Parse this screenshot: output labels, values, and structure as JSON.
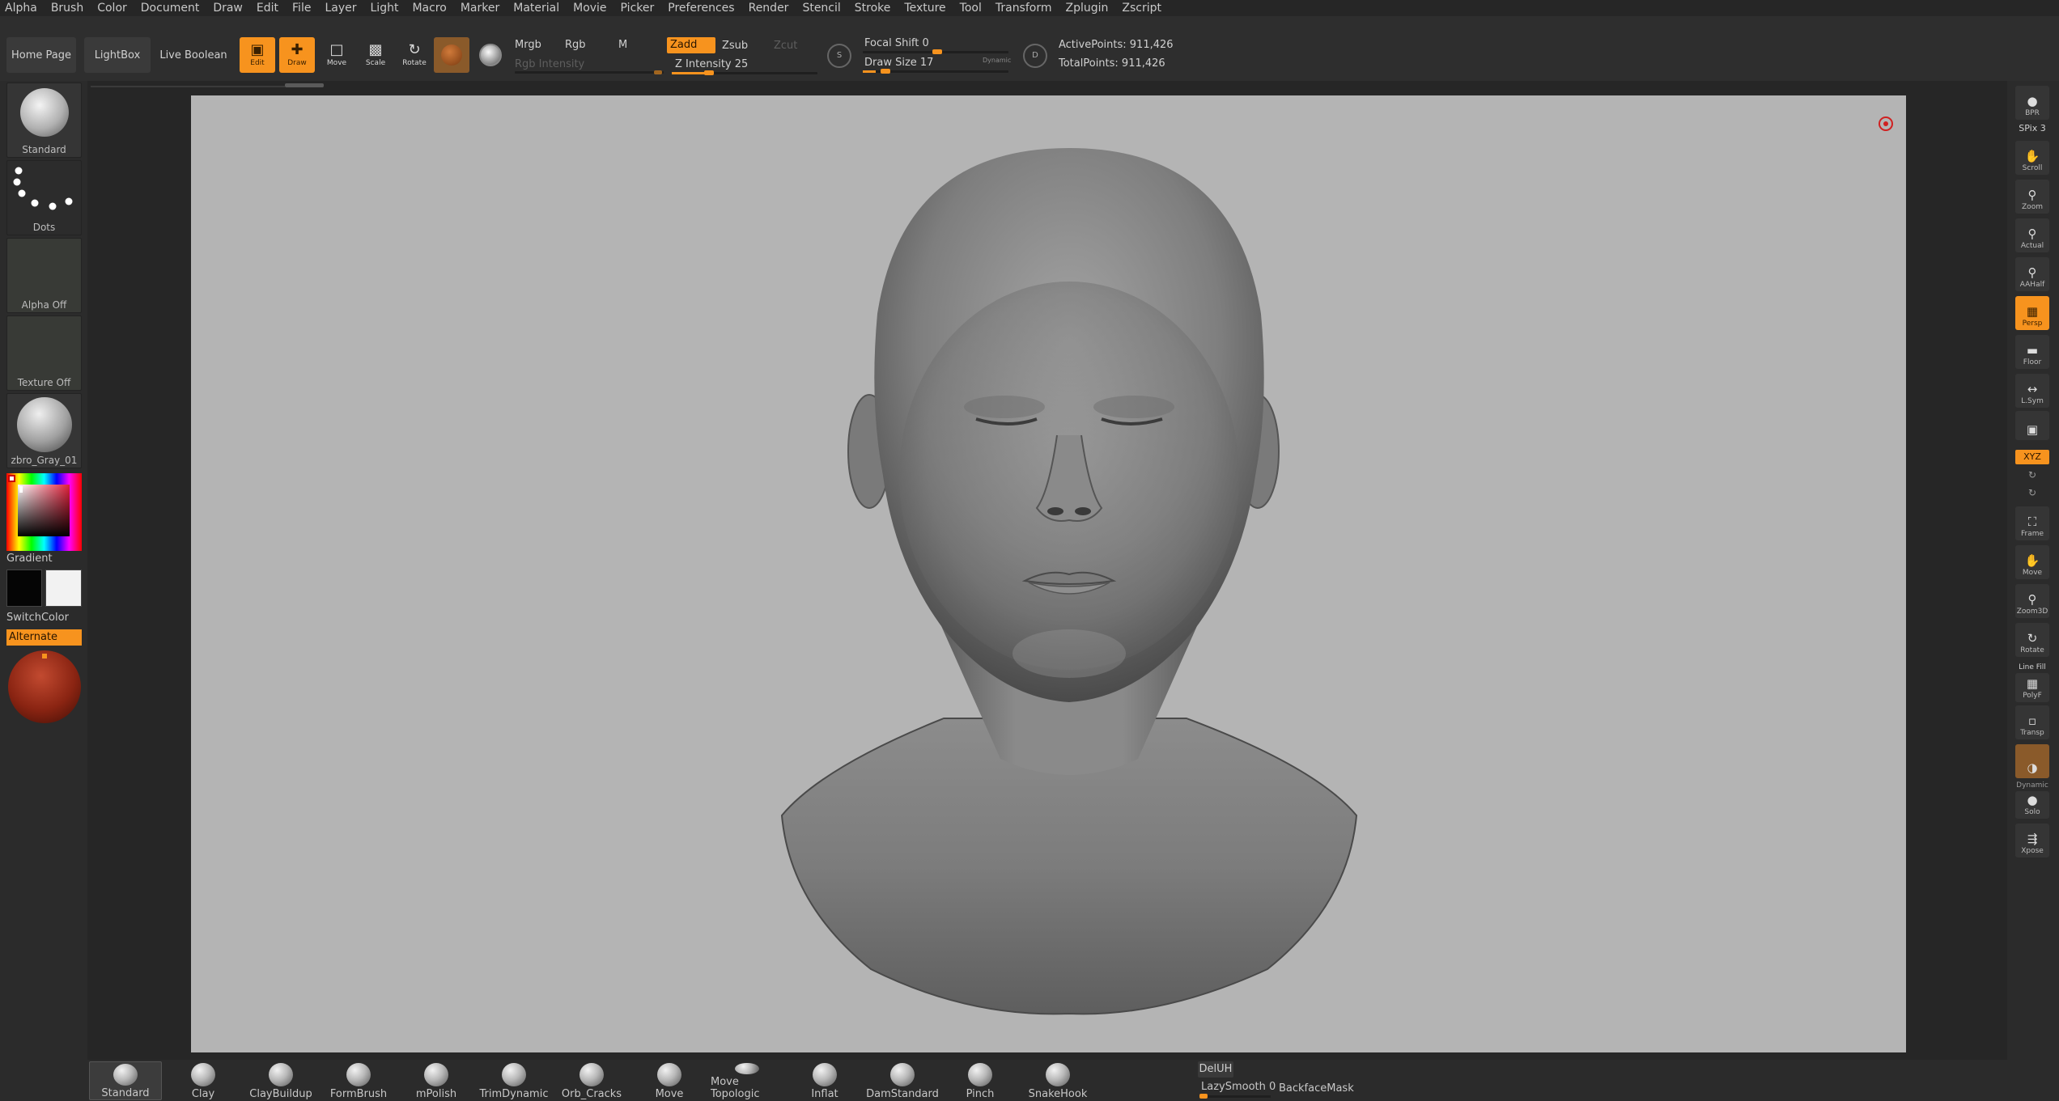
{
  "menu": [
    "Alpha",
    "Brush",
    "Color",
    "Document",
    "Draw",
    "Edit",
    "File",
    "Layer",
    "Light",
    "Macro",
    "Marker",
    "Material",
    "Movie",
    "Picker",
    "Preferences",
    "Render",
    "Stencil",
    "Stroke",
    "Texture",
    "Tool",
    "Transform",
    "Zplugin",
    "Zscript"
  ],
  "toolbar": {
    "home_page": "Home Page",
    "lightbox": "LightBox",
    "live_boolean": "Live Boolean",
    "edit": "Edit",
    "draw": "Draw",
    "move": "Move",
    "scale": "Scale",
    "rotate": "Rotate",
    "mrgb": "Mrgb",
    "rgb": "Rgb",
    "m": "M",
    "rgb_intensity": "Rgb Intensity",
    "zadd": "Zadd",
    "zsub": "Zsub",
    "zcut": "Zcut",
    "z_intensity": "Z Intensity 25",
    "z_intensity_value": 25,
    "focal_shift": "Focal Shift 0",
    "draw_size": "Draw Size 17",
    "dynamic": "Dynamic",
    "active_points": "ActivePoints: 911,426",
    "total_points": "TotalPoints: 911,426"
  },
  "left_shelf": {
    "brush": "Standard",
    "stroke": "Dots",
    "alpha": "Alpha Off",
    "texture": "Texture Off",
    "material": "zbro_Gray_01",
    "gradient": "Gradient",
    "switch_color": "SwitchColor",
    "alternate": "Alternate"
  },
  "right_shelf": {
    "bpr": "BPR",
    "spix": "SPix 3",
    "scroll": "Scroll",
    "zoom": "Zoom",
    "actual": "Actual",
    "aahalf": "AAHalf",
    "persp": "Persp",
    "floor": "Floor",
    "lsym": "L.Sym",
    "xyz": "XYZ",
    "frame": "Frame",
    "move": "Move",
    "zoom3d": "Zoom3D",
    "rotate": "Rotate",
    "line_fill": "Line Fill",
    "polyf": "PolyF",
    "transp": "Transp",
    "dynamic": "Dynamic",
    "solo": "Solo",
    "xpose": "Xpose"
  },
  "bottom_shelf": {
    "brushes": [
      "Standard",
      "Clay",
      "ClayBuildup",
      "FormBrush",
      "mPolish",
      "TrimDynamic",
      "Orb_Cracks",
      "Move",
      "Move Topologic",
      "Inflat",
      "DamStandard",
      "Pinch",
      "SnakeHook"
    ],
    "deluh": "DelUH",
    "lazy_smooth": "LazySmooth 0",
    "backface_mask": "BackfaceMask"
  },
  "colors": {
    "accent": "#f7931e",
    "background": "#2b2b2b",
    "canvas": "#b4b4b4",
    "material_red": "#8a2412"
  }
}
